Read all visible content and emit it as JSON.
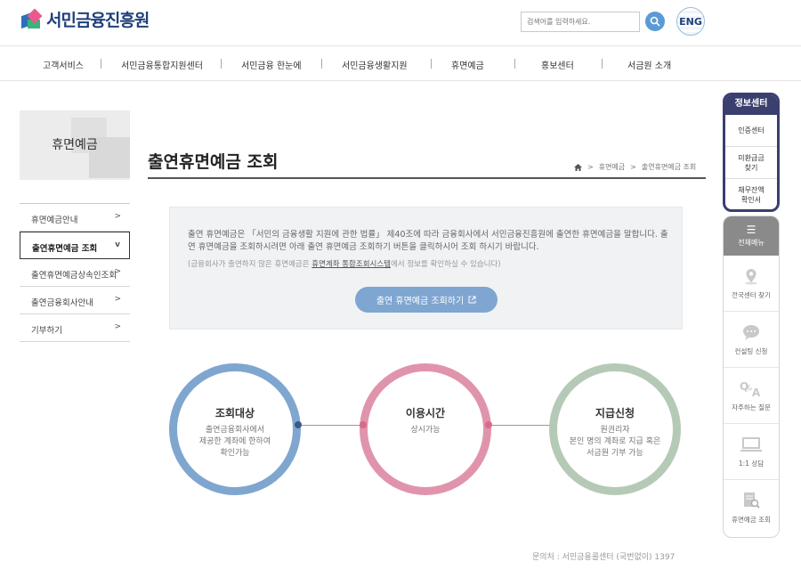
{
  "header": {
    "logo_text": "서민금융진흥원",
    "search_placeholder": "검색어를 입력하세요.",
    "eng_label": "ENG"
  },
  "gnb": [
    "고객서비스",
    "서민금융통합지원센터",
    "서민금융 한눈에",
    "서민금융생활지원",
    "휴면예금",
    "홍보센터",
    "서금원 소개"
  ],
  "lnb": {
    "title": "휴면예금",
    "items": [
      {
        "label": "휴면예금안내",
        "arrow": ">"
      },
      {
        "label": "출연휴면예금 조회",
        "arrow": "v"
      },
      {
        "label": "출연휴면예금상속인조회",
        "arrow": ">"
      },
      {
        "label": "출연금융회사안내",
        "arrow": ">"
      },
      {
        "label": "기부하기",
        "arrow": ">"
      }
    ]
  },
  "main": {
    "title": "출연휴면예금 조회",
    "breadcrumb": [
      ">",
      "휴면예금",
      ">",
      "출연휴면예금 조회"
    ],
    "info_text": "출연 휴면예금은 「서민의 금융생활 지원에 관한 법률」 제40조에 따라 금융회사에서 서민금융진흥원에 출연한 휴면예금을 말합니다. 출연 휴면예금을 조회하시려면 아래 출연 휴면예금 조회하기 버튼을 클릭하시어 조회 하시기 바랍니다.",
    "info_note_prefix": "(금융회사가 출연하지 않은 휴면예금은 ",
    "info_note_link": "휴면계좌 통합조회시스템",
    "info_note_suffix": "에서 정보를 확인하실 수 있습니다)",
    "button_label": "출연 휴면예금 조회하기",
    "steps": [
      {
        "title": "조회대상",
        "desc": "출연금융회사에서\n제공한 계좌에 한하여\n확인가능",
        "color": "#7fa6cf"
      },
      {
        "title": "이용시간",
        "desc": "상시가능",
        "color": "#e094ab"
      },
      {
        "title": "지급신청",
        "desc": "원권리자\n본인 명의 계좌로 지급 혹은\n서금원 기부 가능",
        "color": "#b5c9b7"
      }
    ],
    "dot_colors": [
      "#3a5a8a",
      "#d96a8c",
      "#d96a8c"
    ],
    "contact": "문의처 : 서민금융콜센터 (국번없이) 1397"
  },
  "quick": {
    "info_center": "정보센터",
    "links": [
      "인증센터",
      "미환급금\n찾기",
      "채무잔액\n확인서"
    ],
    "all_menu": "전체메뉴",
    "items": [
      {
        "label": "전국센터 찾기",
        "icon": "map-pin-icon"
      },
      {
        "label": "컨설팅 신청",
        "icon": "chat-bubble-icon"
      },
      {
        "label": "자주하는 질문",
        "icon": "qa-icon"
      },
      {
        "label": "1:1 상담",
        "icon": "monitor-icon"
      },
      {
        "label": "휴면예금 조회",
        "icon": "document-search-icon"
      }
    ]
  }
}
